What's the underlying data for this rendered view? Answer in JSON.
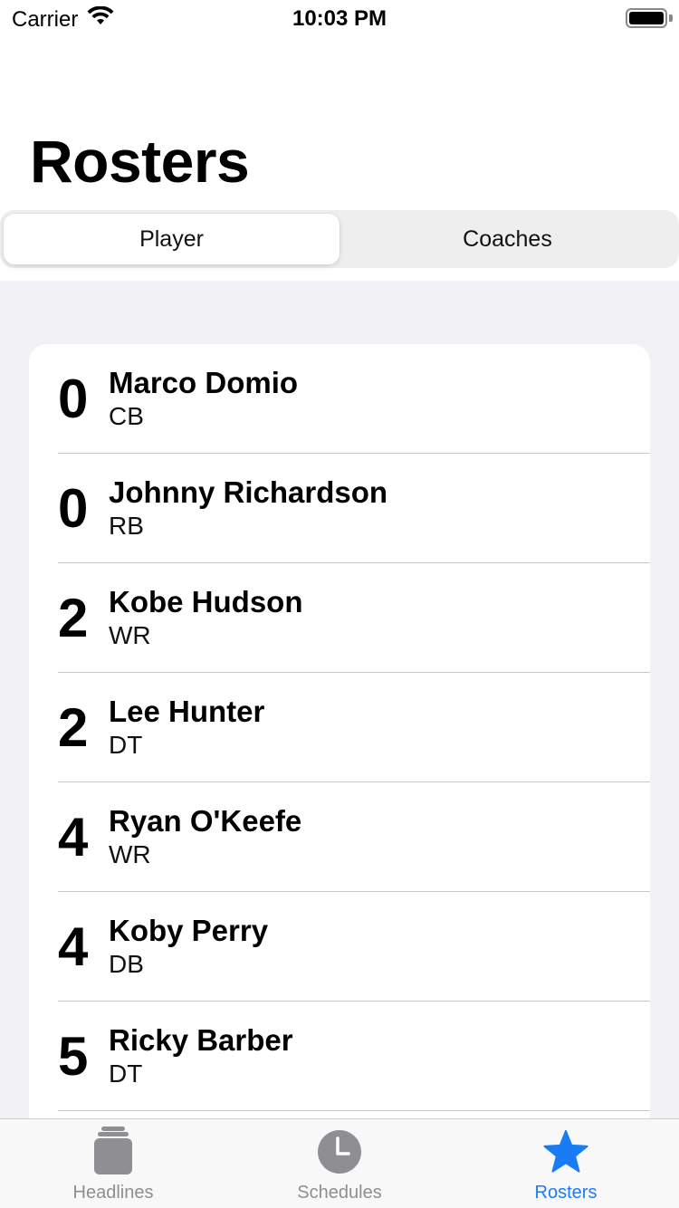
{
  "status_bar": {
    "carrier": "Carrier",
    "time": "10:03 PM",
    "battery_level": 1.0
  },
  "page": {
    "title": "Rosters"
  },
  "segmented_control": {
    "segments": [
      "Player",
      "Coaches"
    ],
    "selected_index": 0
  },
  "roster": {
    "players": [
      {
        "number": "0",
        "name": "Marco Domio",
        "position": "CB"
      },
      {
        "number": "0",
        "name": "Johnny Richardson",
        "position": "RB"
      },
      {
        "number": "2",
        "name": "Kobe Hudson",
        "position": "WR"
      },
      {
        "number": "2",
        "name": "Lee Hunter",
        "position": "DT"
      },
      {
        "number": "4",
        "name": "Ryan O'Keefe",
        "position": "WR"
      },
      {
        "number": "4",
        "name": "Koby Perry",
        "position": "DB"
      },
      {
        "number": "5",
        "name": "Ricky Barber",
        "position": "DT"
      }
    ]
  },
  "tab_bar": {
    "tabs": [
      {
        "label": "Headlines",
        "icon": "newspaper-icon"
      },
      {
        "label": "Schedules",
        "icon": "clock-icon"
      },
      {
        "label": "Rosters",
        "icon": "star-icon"
      }
    ],
    "active_index": 2
  },
  "colors": {
    "accent": "#1a7cf5",
    "inactive": "#8e8e93",
    "list_background": "#f2f2f6"
  }
}
